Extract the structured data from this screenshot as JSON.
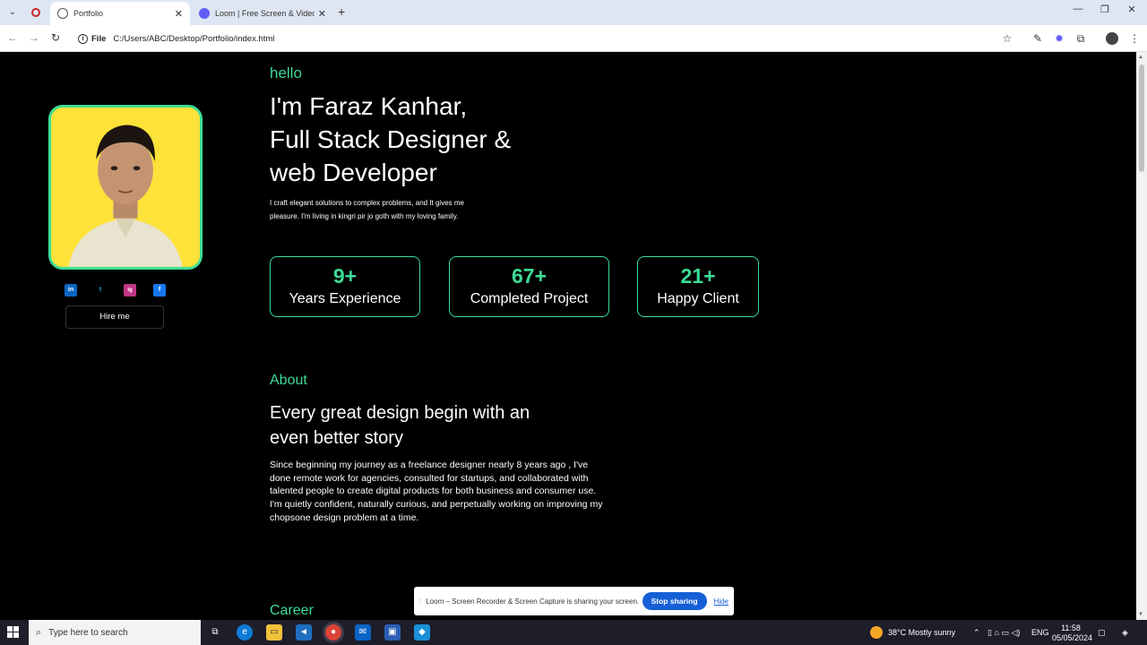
{
  "browser": {
    "tabs": [
      {
        "title": "Portfolio",
        "active": true
      },
      {
        "title": "Loom | Free Screen & Video",
        "active": false
      }
    ],
    "address": {
      "scheme": "File",
      "url": "C:/Users/ABC/Desktop/Portfolio/index.html"
    }
  },
  "profile": {
    "socials": [
      "in",
      "t",
      "ig",
      "f"
    ],
    "hire_label": "Hire me"
  },
  "hero": {
    "greeting": "hello",
    "headline_1": "I'm Faraz Kanhar,",
    "headline_2": "Full Stack Designer &",
    "headline_3": "web Developer",
    "intro": "I craft elegant solutions to complex problems, and It gives me pleasure. I'm living in kingri pir jo goth with my loving family."
  },
  "stats": [
    {
      "value": "9+",
      "label": "Years Experience"
    },
    {
      "value": "67+",
      "label": "Completed Project"
    },
    {
      "value": "21+",
      "label": "Happy Client"
    }
  ],
  "about": {
    "heading": "About",
    "title_1": "Every great design begin with an",
    "title_2": "even better story",
    "text": "Since beginning my journey as a freelance designer nearly 8 years ago , I've done remote work for agencies, consulted for startups, and collaborated with talented people to create digital products for both business and consumer use. I'm quietly confident, naturally curious, and perpetually working on improving my chopsone design problem at a time."
  },
  "career": {
    "heading": "Career"
  },
  "loom_bar": {
    "message": "Loom – Screen Recorder & Screen Capture is sharing your screen.",
    "stop_label": "Stop sharing",
    "hide_label": "Hide"
  },
  "taskbar": {
    "search_placeholder": "Type here to search",
    "weather": "38°C  Mostly sunny",
    "lang": "ENG",
    "time": "11:58",
    "date": "05/05/2024"
  },
  "colors": {
    "accent": "#3ddc97",
    "background": "#000000",
    "loom_blue": "#1560d6"
  }
}
